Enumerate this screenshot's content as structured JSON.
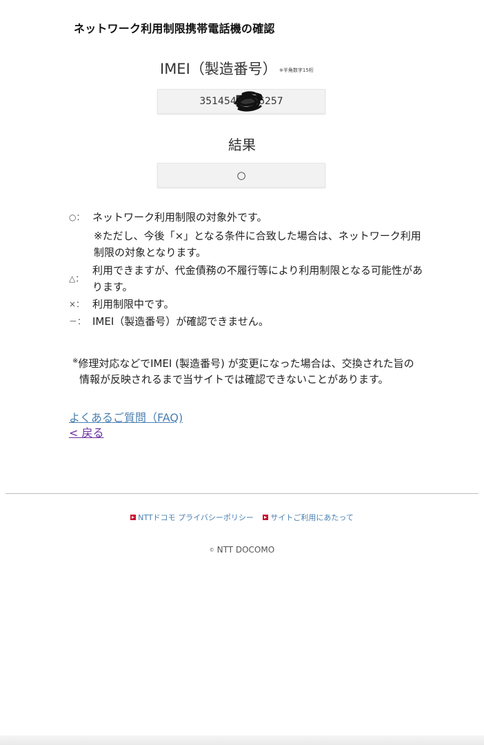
{
  "page": {
    "title": "ネットワーク利用制限携帯電話機の確認"
  },
  "imei": {
    "label": "IMEI（製造番号）",
    "note": "※半角数字15桁",
    "value": "351454███6257"
  },
  "result": {
    "label": "結果",
    "value": "○"
  },
  "legend": {
    "circle_symbol": "○：",
    "circle_text": "ネットワーク利用制限の対象外です。",
    "circle_subnote": "※ただし、今後「×」となる条件に合致した場合は、ネットワーク利用制限の対象となります。",
    "triangle_symbol": "△：",
    "triangle_text": "利用できますが、代金債務の不履行等により利用制限となる可能性があります。",
    "cross_symbol": "×：",
    "cross_text": "利用制限中です。",
    "dash_symbol": "－：",
    "dash_text": "IMEI（製造番号）が確認できません。"
  },
  "footnote": {
    "mark": "※",
    "text": "修理対応などでIMEI (製造番号) が変更になった場合は、交換された旨の情報が反映されるまで当サイトでは確認できないことがあります。"
  },
  "links": {
    "faq": "よくあるご質問（FAQ)",
    "back": "< 戻る"
  },
  "footer": {
    "privacy": "NTTドコモ プライバシーポリシー",
    "terms": "サイトご利用にあたって",
    "copyright_mark": "©",
    "copyright": "NTT DOCOMO"
  },
  "icons": {
    "footer_link_icon": "red-square-arrow-icon",
    "redaction": "scribble-redaction"
  },
  "colors": {
    "link": "#4a7fb0",
    "visited_link": "#6a2e9e",
    "footer_icon": "#c8102e"
  }
}
